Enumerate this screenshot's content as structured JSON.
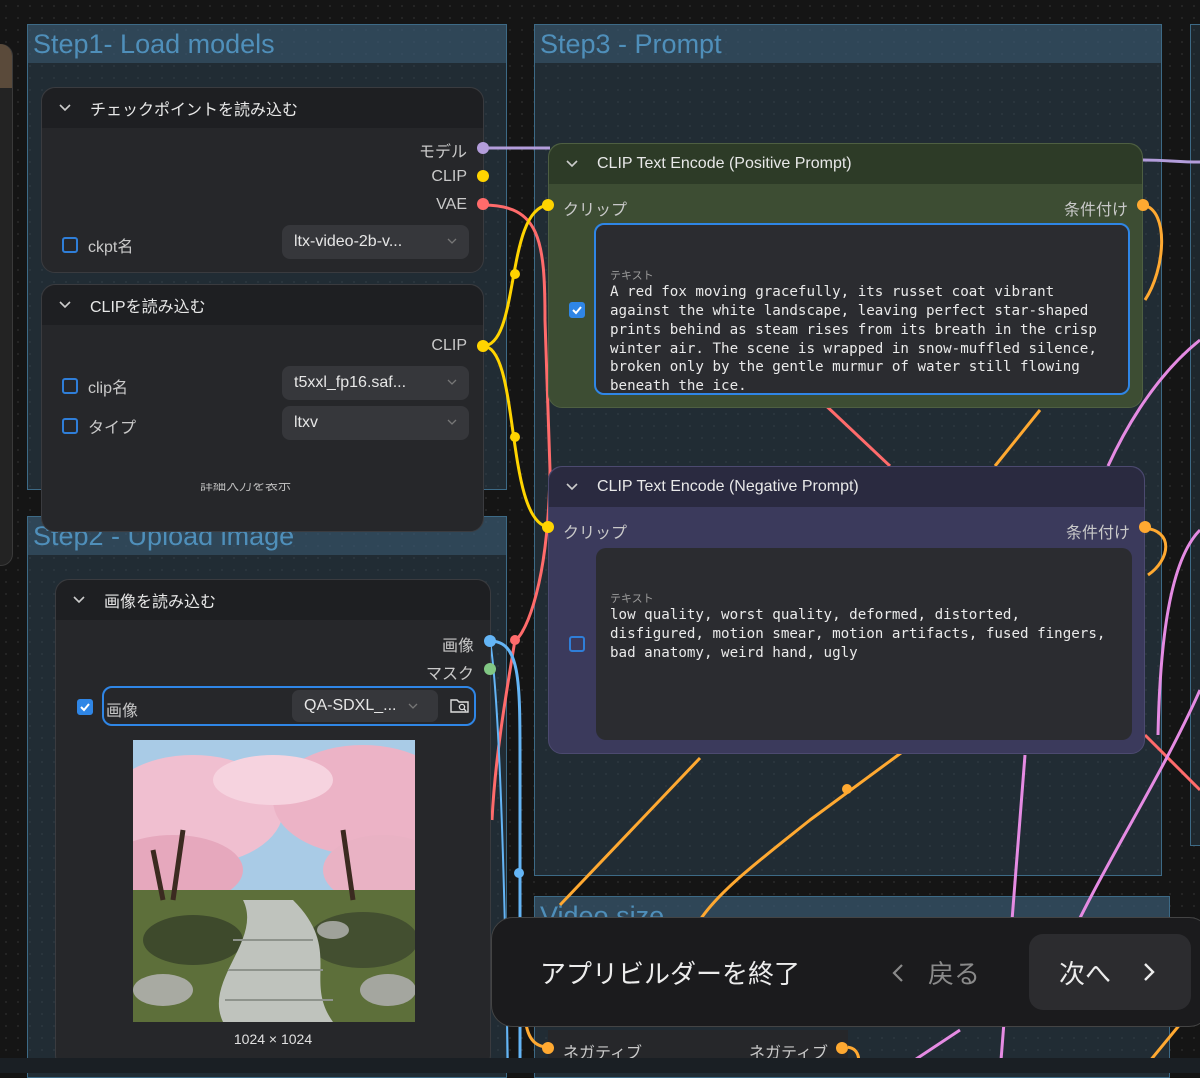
{
  "groups": {
    "step1": "Step1- Load models",
    "step2": "Step2 - Upload image",
    "step3": "Step3 - Prompt",
    "video_size": "Video size"
  },
  "checkpoint_node": {
    "title": "チェックポイントを読み込む",
    "outputs": [
      "モデル",
      "CLIP",
      "VAE"
    ],
    "widget_label": "ckpt名",
    "widget_value": "ltx-video-2b-v..."
  },
  "clip_loader_node": {
    "title": "CLIPを読み込む",
    "output": "CLIP",
    "widgets": [
      {
        "label": "clip名",
        "value": "t5xxl_fp16.saf..."
      },
      {
        "label": "タイプ",
        "value": "ltxv"
      }
    ],
    "footer": "詳細入力を表示"
  },
  "image_node": {
    "title": "画像を読み込む",
    "outputs": [
      "画像",
      "マスク"
    ],
    "widget_label": "画像",
    "widget_value": "QA-SDXL_...",
    "image_size": "1024 × 1024"
  },
  "positive_node": {
    "title": "CLIP Text Encode (Positive Prompt)",
    "input": "クリップ",
    "output": "条件付け",
    "text_label": "テキスト",
    "text": "A red fox moving gracefully, its russet coat vibrant against the white landscape, leaving perfect star-shaped prints behind as steam rises from its breath in the crisp winter air. The scene is wrapped in snow-muffled silence, broken only by the gentle murmur of water still flowing beneath the ice."
  },
  "negative_node": {
    "title": "CLIP Text Encode (Negative Prompt)",
    "input": "クリップ",
    "output": "条件付け",
    "text_label": "テキスト",
    "text": "low quality, worst quality, deformed, distorted, disfigured, motion smear, motion artifacts, fused fingers, bad anatomy, weird hand, ugly"
  },
  "bottom_node": {
    "input": "ネガティブ",
    "output": "ネガティブ"
  },
  "toast": {
    "exit_label": "アプリビルダーを終了",
    "back_label": "戻る",
    "next_label": "次へ"
  },
  "colors": {
    "model": "#b39ddb",
    "clip": "#ffd400",
    "vae": "#ff6b6b",
    "image": "#64b5f6",
    "mask": "#81c784",
    "conditioning": "#ffa931",
    "accent": "#2f86e6"
  }
}
